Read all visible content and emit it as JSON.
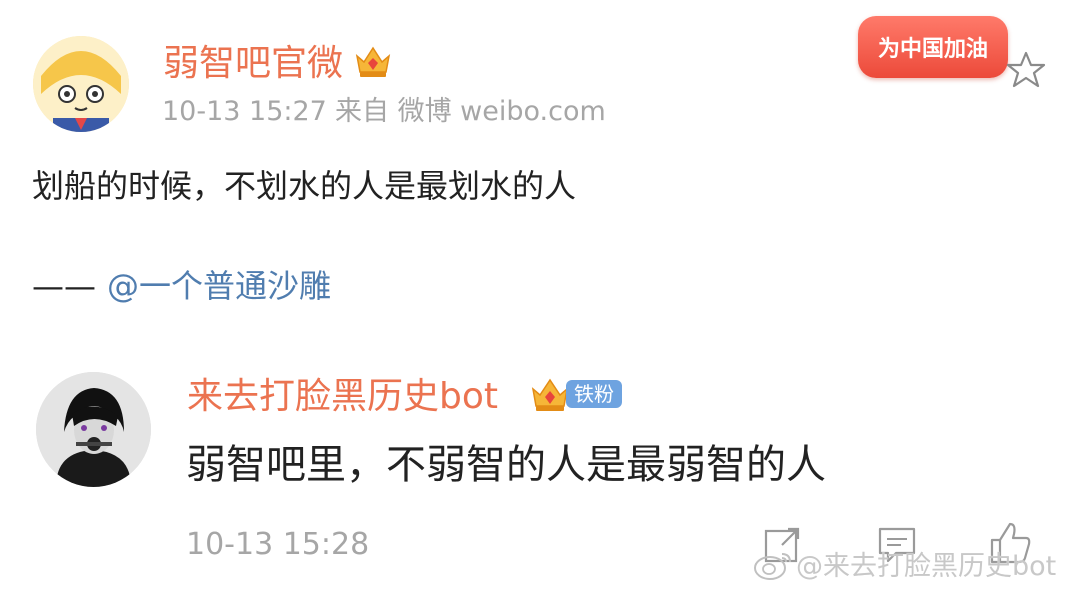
{
  "post": {
    "author": "弱智吧官微",
    "timestamp": "10-13 15:27",
    "source": "来自 微博 weibo.com",
    "content": "划船的时候，不划水的人是最划水的人",
    "attribution_dash": "——",
    "attribution_mention": "@一个普通沙雕",
    "promo_label": "为中国加油"
  },
  "reply": {
    "author": "来去打脸黑历史bot",
    "fan_badge": "铁粉",
    "content": "弱智吧里，不弱智的人是最弱智的人",
    "timestamp": "10-13 15:28"
  },
  "watermark": "@来去打脸黑历史bot",
  "colors": {
    "name": "#eb7350",
    "mention": "#507daf",
    "meta": "#a6a6a6",
    "fan_badge": "#6ea3e0"
  }
}
